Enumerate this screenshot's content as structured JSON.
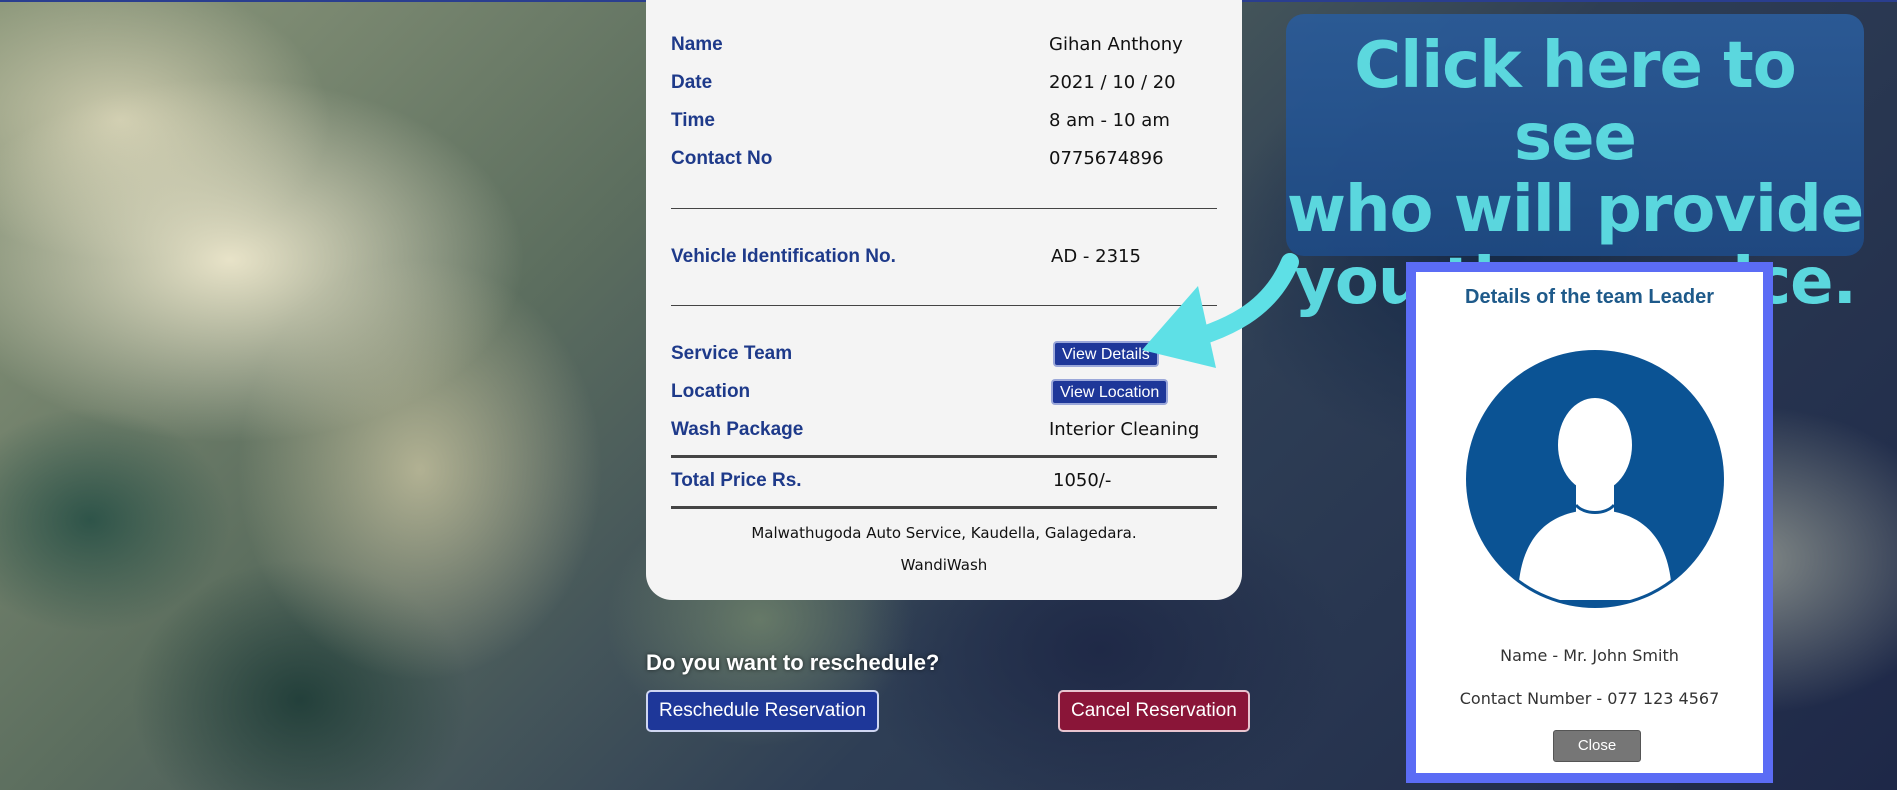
{
  "receipt": {
    "rows": [
      {
        "label": "Name",
        "value": "Gihan Anthony"
      },
      {
        "label": "Date",
        "value": "2021 / 10 / 20"
      },
      {
        "label": "Time",
        "value": "8 am - 10 am"
      },
      {
        "label": "Contact No",
        "value": "0775674896"
      }
    ],
    "vehicle": {
      "label": "Vehicle Identification No.",
      "value": "AD - 2315"
    },
    "service_team": {
      "label": "Service Team",
      "button": "View Details"
    },
    "location": {
      "label": "Location",
      "button": "View Location"
    },
    "wash_package": {
      "label": "Wash Package",
      "value": "Interior Cleaning"
    },
    "total": {
      "label": "Total Price Rs.",
      "value": "1050/-"
    },
    "footer_address": "Malwathugoda Auto Service, Kaudella, Galagedara.",
    "footer_brand": "WandiWash"
  },
  "reschedule": {
    "question": "Do you want to reschedule?",
    "reschedule_button": "Reschedule Reservation",
    "cancel_button": "Cancel Reservation"
  },
  "callout": {
    "lines": [
      "Click here to see",
      "who will provide",
      "you the service."
    ],
    "text_color": "#5ee0e6",
    "background": "#2b5b98"
  },
  "modal": {
    "title": "Details of the team Leader",
    "name_line": "Name - Mr. John Smith",
    "contact_line": "Contact Number - 077 123 4567",
    "close_button": "Close",
    "border_color": "#5b6cf5",
    "avatar_color": "#0b5394"
  },
  "colors": {
    "label_blue": "#1e3a8a",
    "primary_button": "#1e3799",
    "cancel_button": "#8a1538"
  }
}
